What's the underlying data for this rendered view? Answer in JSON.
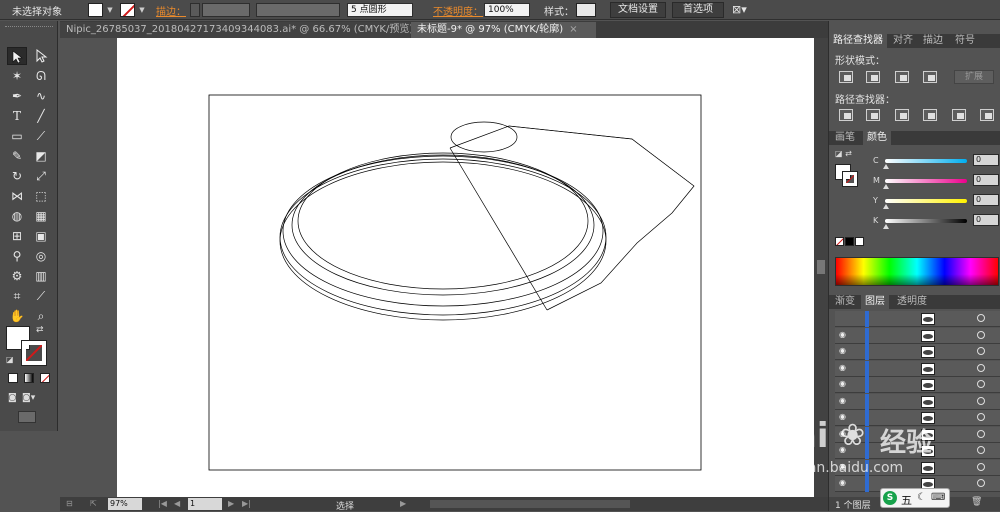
{
  "control_bar": {
    "selection_status": "未选择对象",
    "stroke_label": "描边：",
    "brush_label": "5 点圆形",
    "opacity_label": "不透明度：",
    "opacity_value": "100%",
    "style_label": "样式：",
    "doc_settings_button": "文档设置",
    "preferences_button": "首选项",
    "fill_color": "#ffffff",
    "stroke_color": "none"
  },
  "tabs": [
    {
      "label": "Nipic_26785037_20180427173409344083.ai* @ 66.67% (CMYK/预览)",
      "close": "×",
      "active": false
    },
    {
      "label": "未标题-9* @ 97% (CMYK/轮廓)",
      "close": "×",
      "active": true
    }
  ],
  "status_bar": {
    "zoom": "97%",
    "artboard_number": "1",
    "tool_name": "选择"
  },
  "pathfinder": {
    "tabs": [
      "路径查找器",
      "对齐",
      "描边",
      "符号"
    ],
    "shape_modes_label": "形状模式：",
    "expand_button": "扩展",
    "pathfinders_label": "路径查找器："
  },
  "color": {
    "tabs": [
      "画笔",
      "颜色"
    ],
    "channels": [
      {
        "name": "C",
        "value": "0",
        "gradient": "linear-gradient(to right,#fff,#00aeef)"
      },
      {
        "name": "M",
        "value": "0",
        "gradient": "linear-gradient(to right,#fff,#ec008c)"
      },
      {
        "name": "Y",
        "value": "0",
        "gradient": "linear-gradient(to right,#fff,#fff200)"
      },
      {
        "name": "K",
        "value": "0",
        "gradient": "linear-gradient(to right,#fff,#000)"
      }
    ]
  },
  "layers": {
    "tabs": [
      "渐变",
      "图层",
      "透明度"
    ],
    "count_label": "1 个图层",
    "row_count": 11
  },
  "watermark": {
    "brand": "Bai",
    "brand2": "经验",
    "url": "jingyan.baidu.com"
  },
  "ime": {
    "label": "五"
  }
}
